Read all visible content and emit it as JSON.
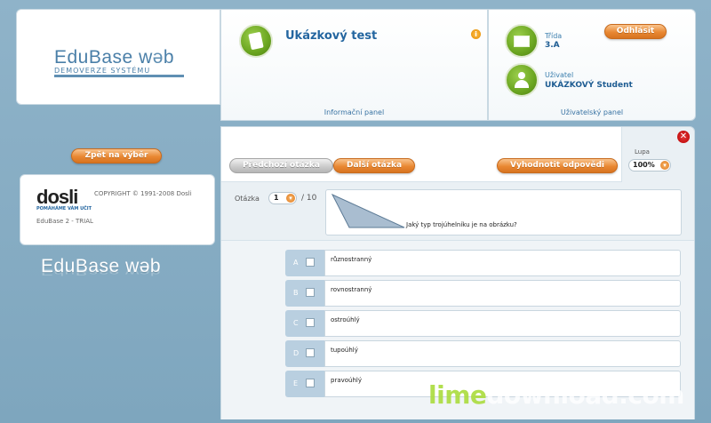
{
  "brand": {
    "name_part1": "EduBase w",
    "name_part2": "b",
    "subtitle": "DEMOVERZE SYSTÉMU"
  },
  "info_panel": {
    "test_title": "Ukázkový test",
    "caption": "Informační panel",
    "info_badge": "i"
  },
  "user_panel": {
    "class_label": "Třída",
    "class_value": "3.A",
    "user_label": "Uživatel",
    "user_value": "UKÁZKOVÝ Student",
    "logout_label": "Odhlásit",
    "caption": "Uživatelský panel"
  },
  "sidebar": {
    "back_label": "Zpět na výběr",
    "dosli_logo": "dosli",
    "dosli_tagline": "POMÁHÁME VÁM UČIT",
    "copyright": "COPYRIGHT © 1991-2008 Dosli",
    "version": "EduBase 2 - TRIAL",
    "bottom_logo": "EduBase w b"
  },
  "toolbar": {
    "prev_label": "Předchozí otázka",
    "next_label": "Další otázka",
    "evaluate_label": "Vyhodnotit odpovědi",
    "zoom_label": "Lupa",
    "zoom_value": "100%",
    "close_glyph": "✕"
  },
  "question": {
    "label": "Otázka",
    "current": "1",
    "total": "/ 10",
    "text": "Jaký typ trojúhelníku je na obrázku?"
  },
  "answers": [
    {
      "letter": "A",
      "text": "různostranný"
    },
    {
      "letter": "B",
      "text": "rovnostranný"
    },
    {
      "letter": "C",
      "text": "ostroúhlý"
    },
    {
      "letter": "D",
      "text": "tupoúhlý"
    },
    {
      "letter": "E",
      "text": "pravoúhlý"
    }
  ],
  "watermark": {
    "lime": "lime",
    "rest": "download.com"
  },
  "colors": {
    "accent_orange": "#e98833",
    "brand_blue": "#2466a0",
    "icon_green": "#6aa520",
    "background": "#8fb3c9"
  }
}
